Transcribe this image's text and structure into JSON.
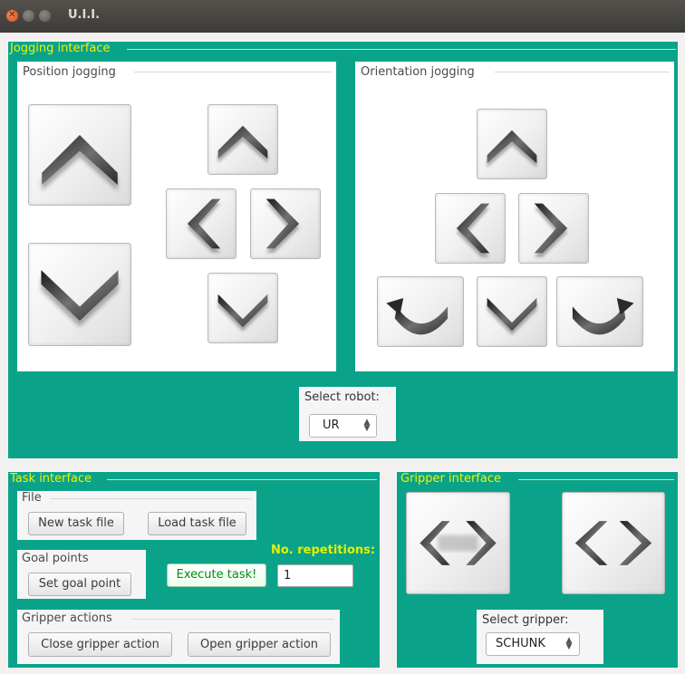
{
  "window": {
    "title": "U.I.I."
  },
  "jogging": {
    "title": "Jogging interface",
    "position": {
      "title": "Position jogging",
      "buttons": [
        "z-up-icon",
        "z-down-icon",
        "up-icon",
        "left-icon",
        "right-icon",
        "down-icon"
      ]
    },
    "orientation": {
      "title": "Orientation jogging",
      "buttons": [
        "up-icon",
        "left-icon",
        "right-icon",
        "rotate-ccw-icon",
        "down-icon",
        "rotate-cw-icon"
      ]
    },
    "select_robot": {
      "label": "Select robot:",
      "value": "UR"
    }
  },
  "task": {
    "title": "Task interface",
    "file": {
      "label": "File",
      "new_button": "New task file",
      "load_button": "Load task file"
    },
    "goal_points": {
      "label": "Goal points",
      "set_button": "Set goal point"
    },
    "execute_button": "Execute task!",
    "repetitions": {
      "label": "No. repetitions:",
      "value": "1"
    },
    "gripper_actions": {
      "label": "Gripper actions",
      "close_button": "Close gripper action",
      "open_button": "Open gripper action"
    }
  },
  "gripper": {
    "title": "Gripper interface",
    "buttons": [
      "gripper-close-icon",
      "gripper-open-icon"
    ],
    "select_gripper": {
      "label": "Select gripper:",
      "value": "SCHUNK"
    }
  },
  "colors": {
    "panel": "#0aa38a",
    "group_title": "#f2f200",
    "execute_text": "#0a8a1a"
  }
}
